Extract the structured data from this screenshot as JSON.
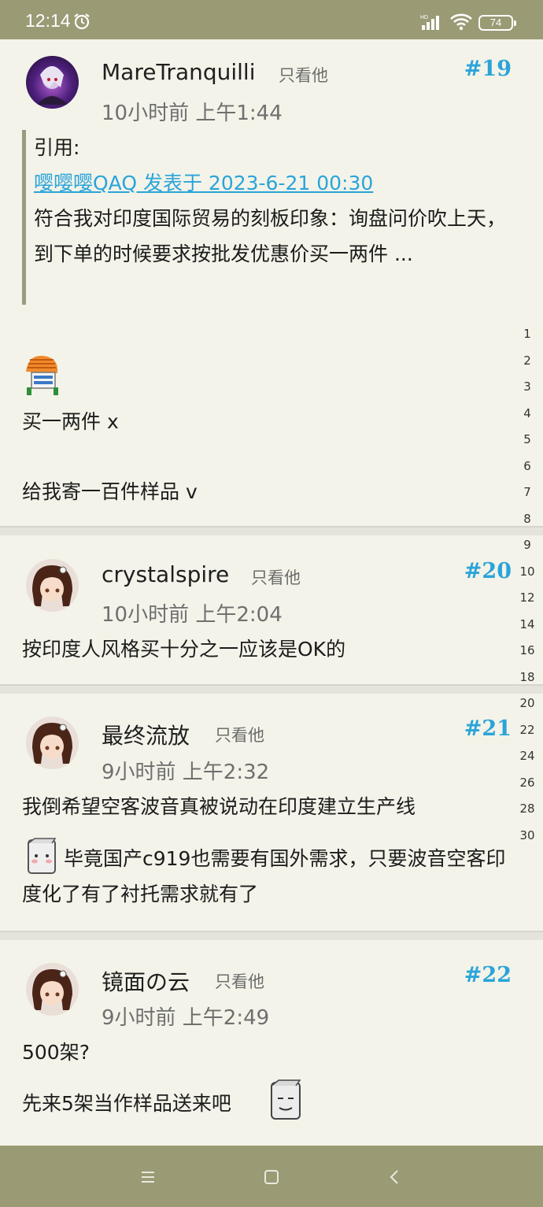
{
  "status_bar": {
    "time": "12:14",
    "battery": "74",
    "network": "HD"
  },
  "posts": [
    {
      "username": "MareTranquilli",
      "only_him": "只看他",
      "floor": "#19",
      "time": "10小时前 上午1:44",
      "quote": {
        "label": "引用:",
        "link": "嘤嘤嘤QAQ 发表于 2023-6-21 00:30",
        "text": "符合我对印度国际贸易的刻板印象：询盘问价吹上天，到下单的时候要求按批发优惠价买一两件 ..."
      },
      "lines": [
        "买一两件 x",
        "给我寄一百件样品 v"
      ]
    },
    {
      "username": "crystalspire",
      "only_him": "只看他",
      "floor": "#20",
      "time": "10小时前 上午2:04",
      "lines": [
        "按印度人风格买十分之一应该是OK的"
      ]
    },
    {
      "username": "最终流放",
      "only_him": "只看他",
      "floor": "#21",
      "time": "9小时前 上午2:32",
      "lines": [
        "我倒希望空客波音真被说动在印度建立生产线",
        "毕竟国产c919也需要有国外需求，只要波音空客印度化了有了衬托需求就有了"
      ]
    },
    {
      "username": "镜面の云",
      "only_him": "只看他",
      "floor": "#22",
      "time": "9小时前 上午2:49",
      "lines": [
        "500架?",
        "先来5架当作样品送来吧"
      ]
    }
  ],
  "page_index": [
    "1",
    "2",
    "3",
    "4",
    "5",
    "6",
    "7",
    "8",
    "9",
    "10",
    "12",
    "14",
    "16",
    "18",
    "20",
    "22",
    "24",
    "26",
    "28",
    "30"
  ],
  "nav": {
    "menu_icon": "menu-icon",
    "home_icon": "home-icon",
    "back_icon": "back-icon"
  }
}
